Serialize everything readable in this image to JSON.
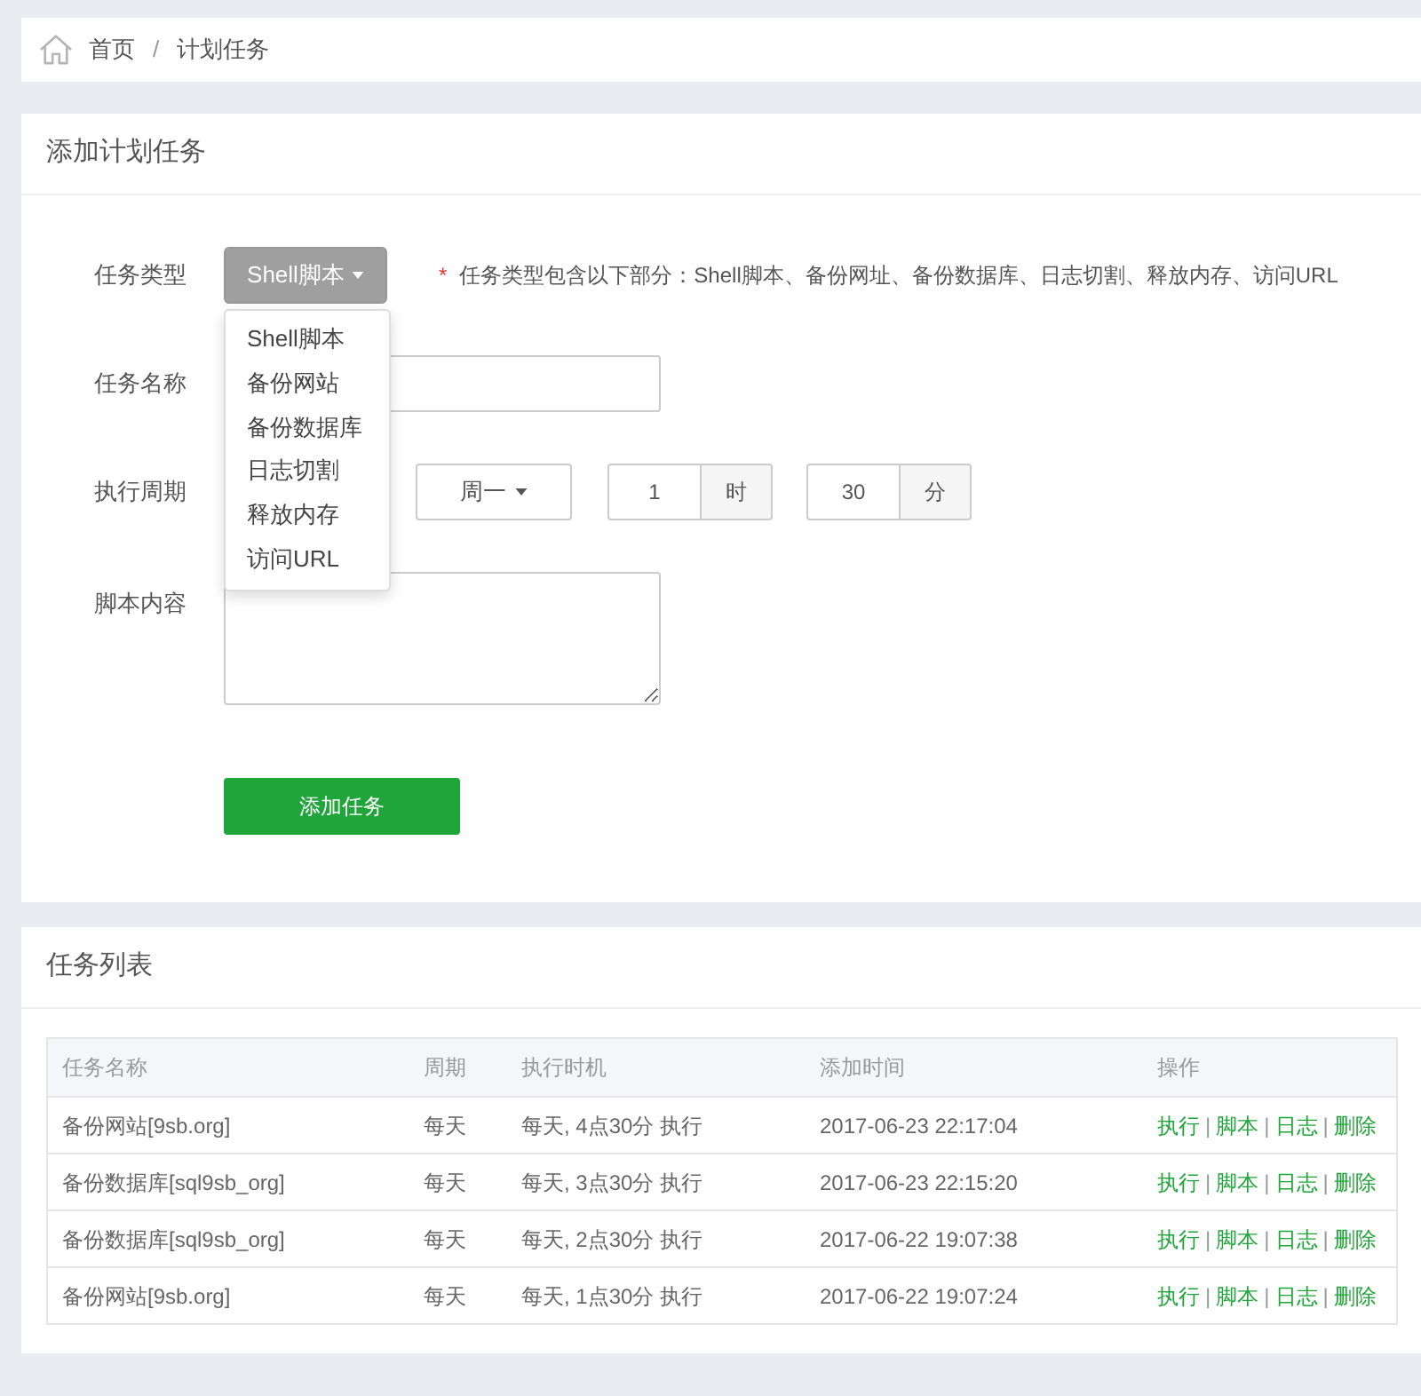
{
  "breadcrumb": {
    "items": [
      {
        "text": "首页"
      },
      {
        "text": "计划任务"
      }
    ],
    "separator": "/"
  },
  "add_task": {
    "title": "添加计划任务",
    "task_type": {
      "label": "任务类型",
      "value": "Shell脚本",
      "expanded": true,
      "options": [
        "Shell脚本",
        "备份网站",
        "备份数据库",
        "日志切割",
        "释放内存",
        "访问URL"
      ],
      "note_mark": "*",
      "note": "任务类型包含以下部分：Shell脚本、备份网址、备份数据库、日志切割、释放内存、访问URL"
    },
    "task_name": {
      "label": "任务名称"
    },
    "period": {
      "label": "执行周期",
      "weekday": "周一",
      "hour": "1",
      "hour_unit": "时",
      "minute": "30",
      "minute_unit": "分"
    },
    "script": {
      "label": "脚本内容"
    },
    "submit": "添加任务"
  },
  "task_list": {
    "title": "任务列表",
    "columns": [
      "任务名称",
      "周期",
      "执行时机",
      "添加时间",
      "操作"
    ],
    "rows": [
      {
        "name": "备份网站[9sb.org]",
        "cycle": "每天",
        "timing": "每天, 4点30分 执行",
        "added": "2017-06-23 22:17:04",
        "actions": [
          {
            "kind": "link",
            "text": "执行"
          },
          {
            "kind": "separator",
            "text": "|"
          },
          {
            "kind": "link",
            "text": "脚本"
          },
          {
            "kind": "separator",
            "text": "|"
          },
          {
            "kind": "link",
            "text": "日志"
          },
          {
            "kind": "separator",
            "text": "|"
          },
          {
            "kind": "link",
            "text": "删除"
          }
        ]
      },
      {
        "name": "备份数据库[sql9sb_org]",
        "cycle": "每天",
        "timing": "每天, 3点30分 执行",
        "added": "2017-06-23 22:15:20",
        "actions": [
          {
            "kind": "link",
            "text": "执行"
          },
          {
            "kind": "separator",
            "text": "|"
          },
          {
            "kind": "link",
            "text": "脚本"
          },
          {
            "kind": "separator",
            "text": "|"
          },
          {
            "kind": "link",
            "text": "日志"
          },
          {
            "kind": "separator",
            "text": "|"
          },
          {
            "kind": "link",
            "text": "删除"
          }
        ]
      },
      {
        "name": "备份数据库[sql9sb_org]",
        "cycle": "每天",
        "timing": "每天, 2点30分 执行",
        "added": "2017-06-22 19:07:38",
        "actions": [
          {
            "kind": "link",
            "text": "执行"
          },
          {
            "kind": "separator",
            "text": "|"
          },
          {
            "kind": "link",
            "text": "脚本"
          },
          {
            "kind": "separator",
            "text": "|"
          },
          {
            "kind": "link",
            "text": "日志"
          },
          {
            "kind": "separator",
            "text": "|"
          },
          {
            "kind": "link",
            "text": "删除"
          }
        ]
      },
      {
        "name": "备份网站[9sb.org]",
        "cycle": "每天",
        "timing": "每天, 1点30分 执行",
        "added": "2017-06-22 19:07:24",
        "actions": [
          {
            "kind": "link",
            "text": "执行"
          },
          {
            "kind": "separator",
            "text": "|"
          },
          {
            "kind": "link",
            "text": "脚本"
          },
          {
            "kind": "separator",
            "text": "|"
          },
          {
            "kind": "link",
            "text": "日志"
          },
          {
            "kind": "separator",
            "text": "|"
          },
          {
            "kind": "link",
            "text": "删除"
          }
        ]
      }
    ]
  }
}
